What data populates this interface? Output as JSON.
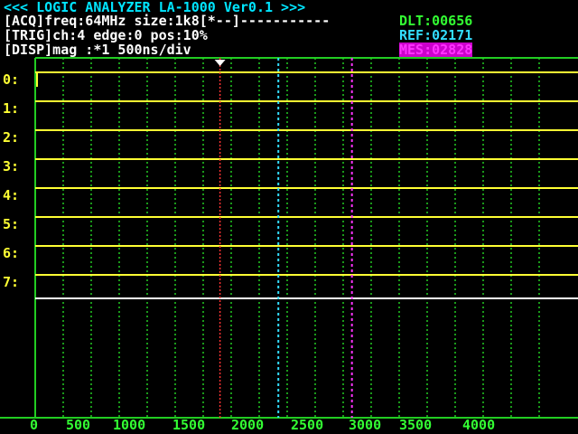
{
  "header": {
    "title": "<<< LOGIC ANALYZER LA-1000 Ver0.1 >>>",
    "acq_line": "[ACQ]freq:64MHz size:1k8[*--]-----------",
    "trig_line": "[TRIG]ch:4 edge:0 pos:10%",
    "disp_line": "[DISP]mag :*1 500ns/div",
    "dlt": "DLT:00656",
    "ref": "REF:02171",
    "mes": "MES:02828"
  },
  "channels": [
    "0:",
    "1:",
    "2:",
    "3:",
    "4:",
    "5:",
    "6:",
    "7:"
  ],
  "time_axis": {
    "ticks": [
      "0",
      "500",
      "1000",
      "1500",
      "2000",
      "2500",
      "3000",
      "3500",
      "4000"
    ]
  },
  "colors": {
    "background": "#000000",
    "grid": "#22cc22",
    "channel_trace": "#ffff33",
    "trigger_marker": "#ff3333",
    "ref_cursor": "#33ddff",
    "mes_cursor": "#ff33ff",
    "title": "#00e5ff",
    "dlt": "#33ff33"
  },
  "cursors": {
    "trigger": 1650,
    "ref": 2171,
    "mes": 2828
  }
}
